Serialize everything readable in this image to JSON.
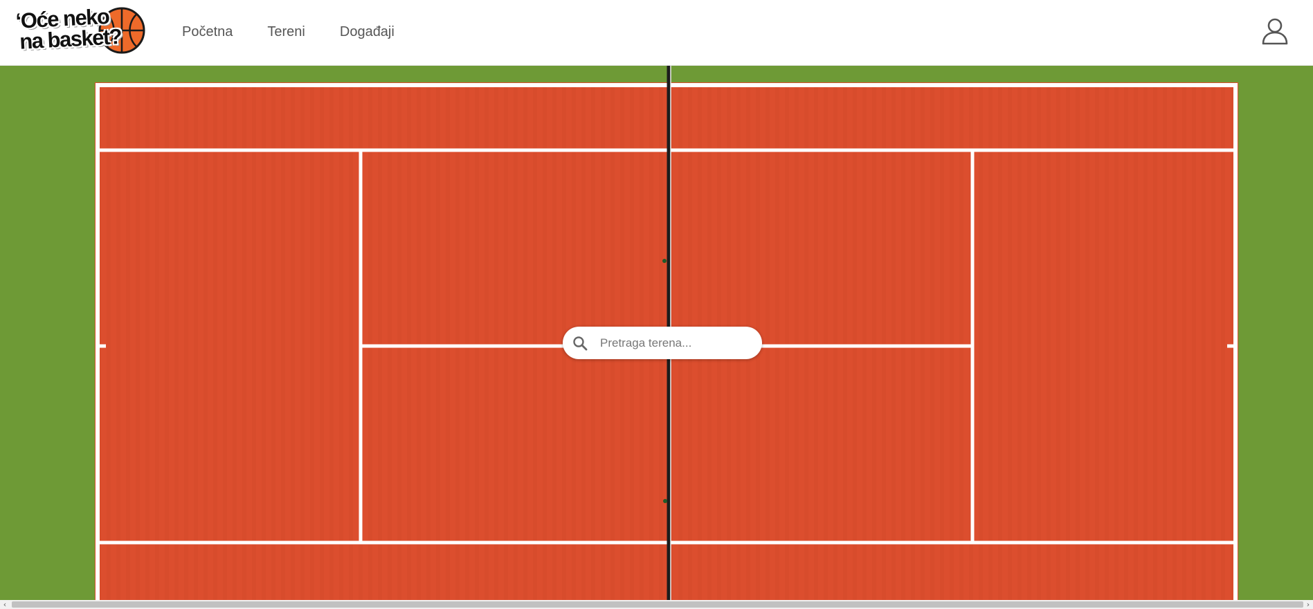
{
  "logo": {
    "line1": "‘Oće neko",
    "line2": "na basket?",
    "ball_icon": "basketball-icon"
  },
  "nav": {
    "items": [
      {
        "label": "Početna"
      },
      {
        "label": "Tereni"
      },
      {
        "label": "Događaji"
      }
    ]
  },
  "header": {
    "user_icon": "user-icon"
  },
  "hero": {
    "background": "aerial clay tennis court",
    "colors": {
      "grass": "#6e9a36",
      "clay": "#dc4e2e",
      "lines": "#ffffff"
    }
  },
  "search": {
    "placeholder": "Pretraga terena...",
    "value": "",
    "icon": "search-icon"
  },
  "scrollbar": {
    "left_arrow": "‹",
    "right_arrow": "›"
  }
}
